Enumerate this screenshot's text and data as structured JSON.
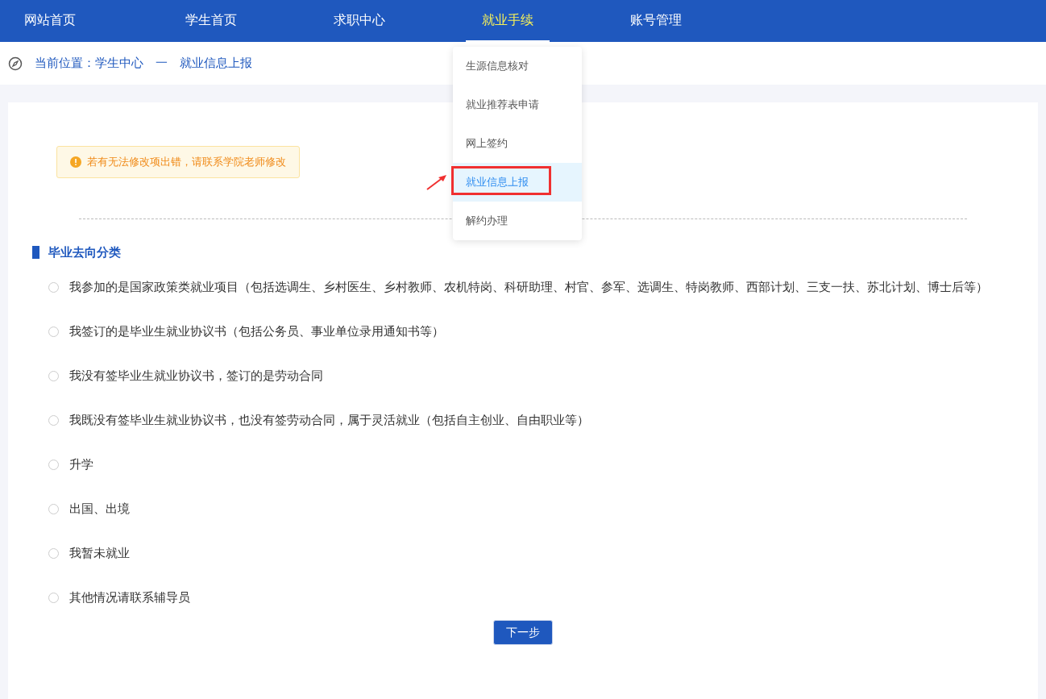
{
  "nav": [
    {
      "label": "网站首页",
      "selected": false
    },
    {
      "label": "学生首页",
      "selected": false
    },
    {
      "label": "求职中心",
      "selected": false
    },
    {
      "label": "就业手续",
      "selected": true
    },
    {
      "label": "账号管理",
      "selected": false
    }
  ],
  "dropdown": [
    {
      "label": "生源信息核对",
      "selected": false,
      "annotated": false
    },
    {
      "label": "就业推荐表申请",
      "selected": false,
      "annotated": false
    },
    {
      "label": "网上签约",
      "selected": false,
      "annotated": false
    },
    {
      "label": "就业信息上报",
      "selected": true,
      "annotated": true
    },
    {
      "label": "解约办理",
      "selected": false,
      "annotated": false
    }
  ],
  "breadcrumb": "当前位置：学生中心　一　就业信息上报",
  "alert": "若有无法修改项出错，请联系学院老师修改",
  "section_title": "毕业去向分类",
  "options": [
    {
      "label": "我参加的是国家政策类就业项目（包括选调生、乡村医生、乡村教师、农机特岗、科研助理、村官、参军、选调生、特岗教师、西部计划、三支一扶、苏北计划、博士后等）",
      "selected": false
    },
    {
      "label": "我签订的是毕业生就业协议书（包括公务员、事业单位录用通知书等）",
      "selected": false
    },
    {
      "label": "我没有签毕业生就业协议书，签订的是劳动合同",
      "selected": false
    },
    {
      "label": "我既没有签毕业生就业协议书，也没有签劳动合同，属于灵活就业（包括自主创业、自由职业等）",
      "selected": false
    },
    {
      "label": "升学",
      "selected": false
    },
    {
      "label": "出国、出境",
      "selected": false
    },
    {
      "label": "我暂未就业",
      "selected": false
    },
    {
      "label": "其他情况请联系辅导员",
      "selected": false
    }
  ],
  "next_button": "下一步"
}
